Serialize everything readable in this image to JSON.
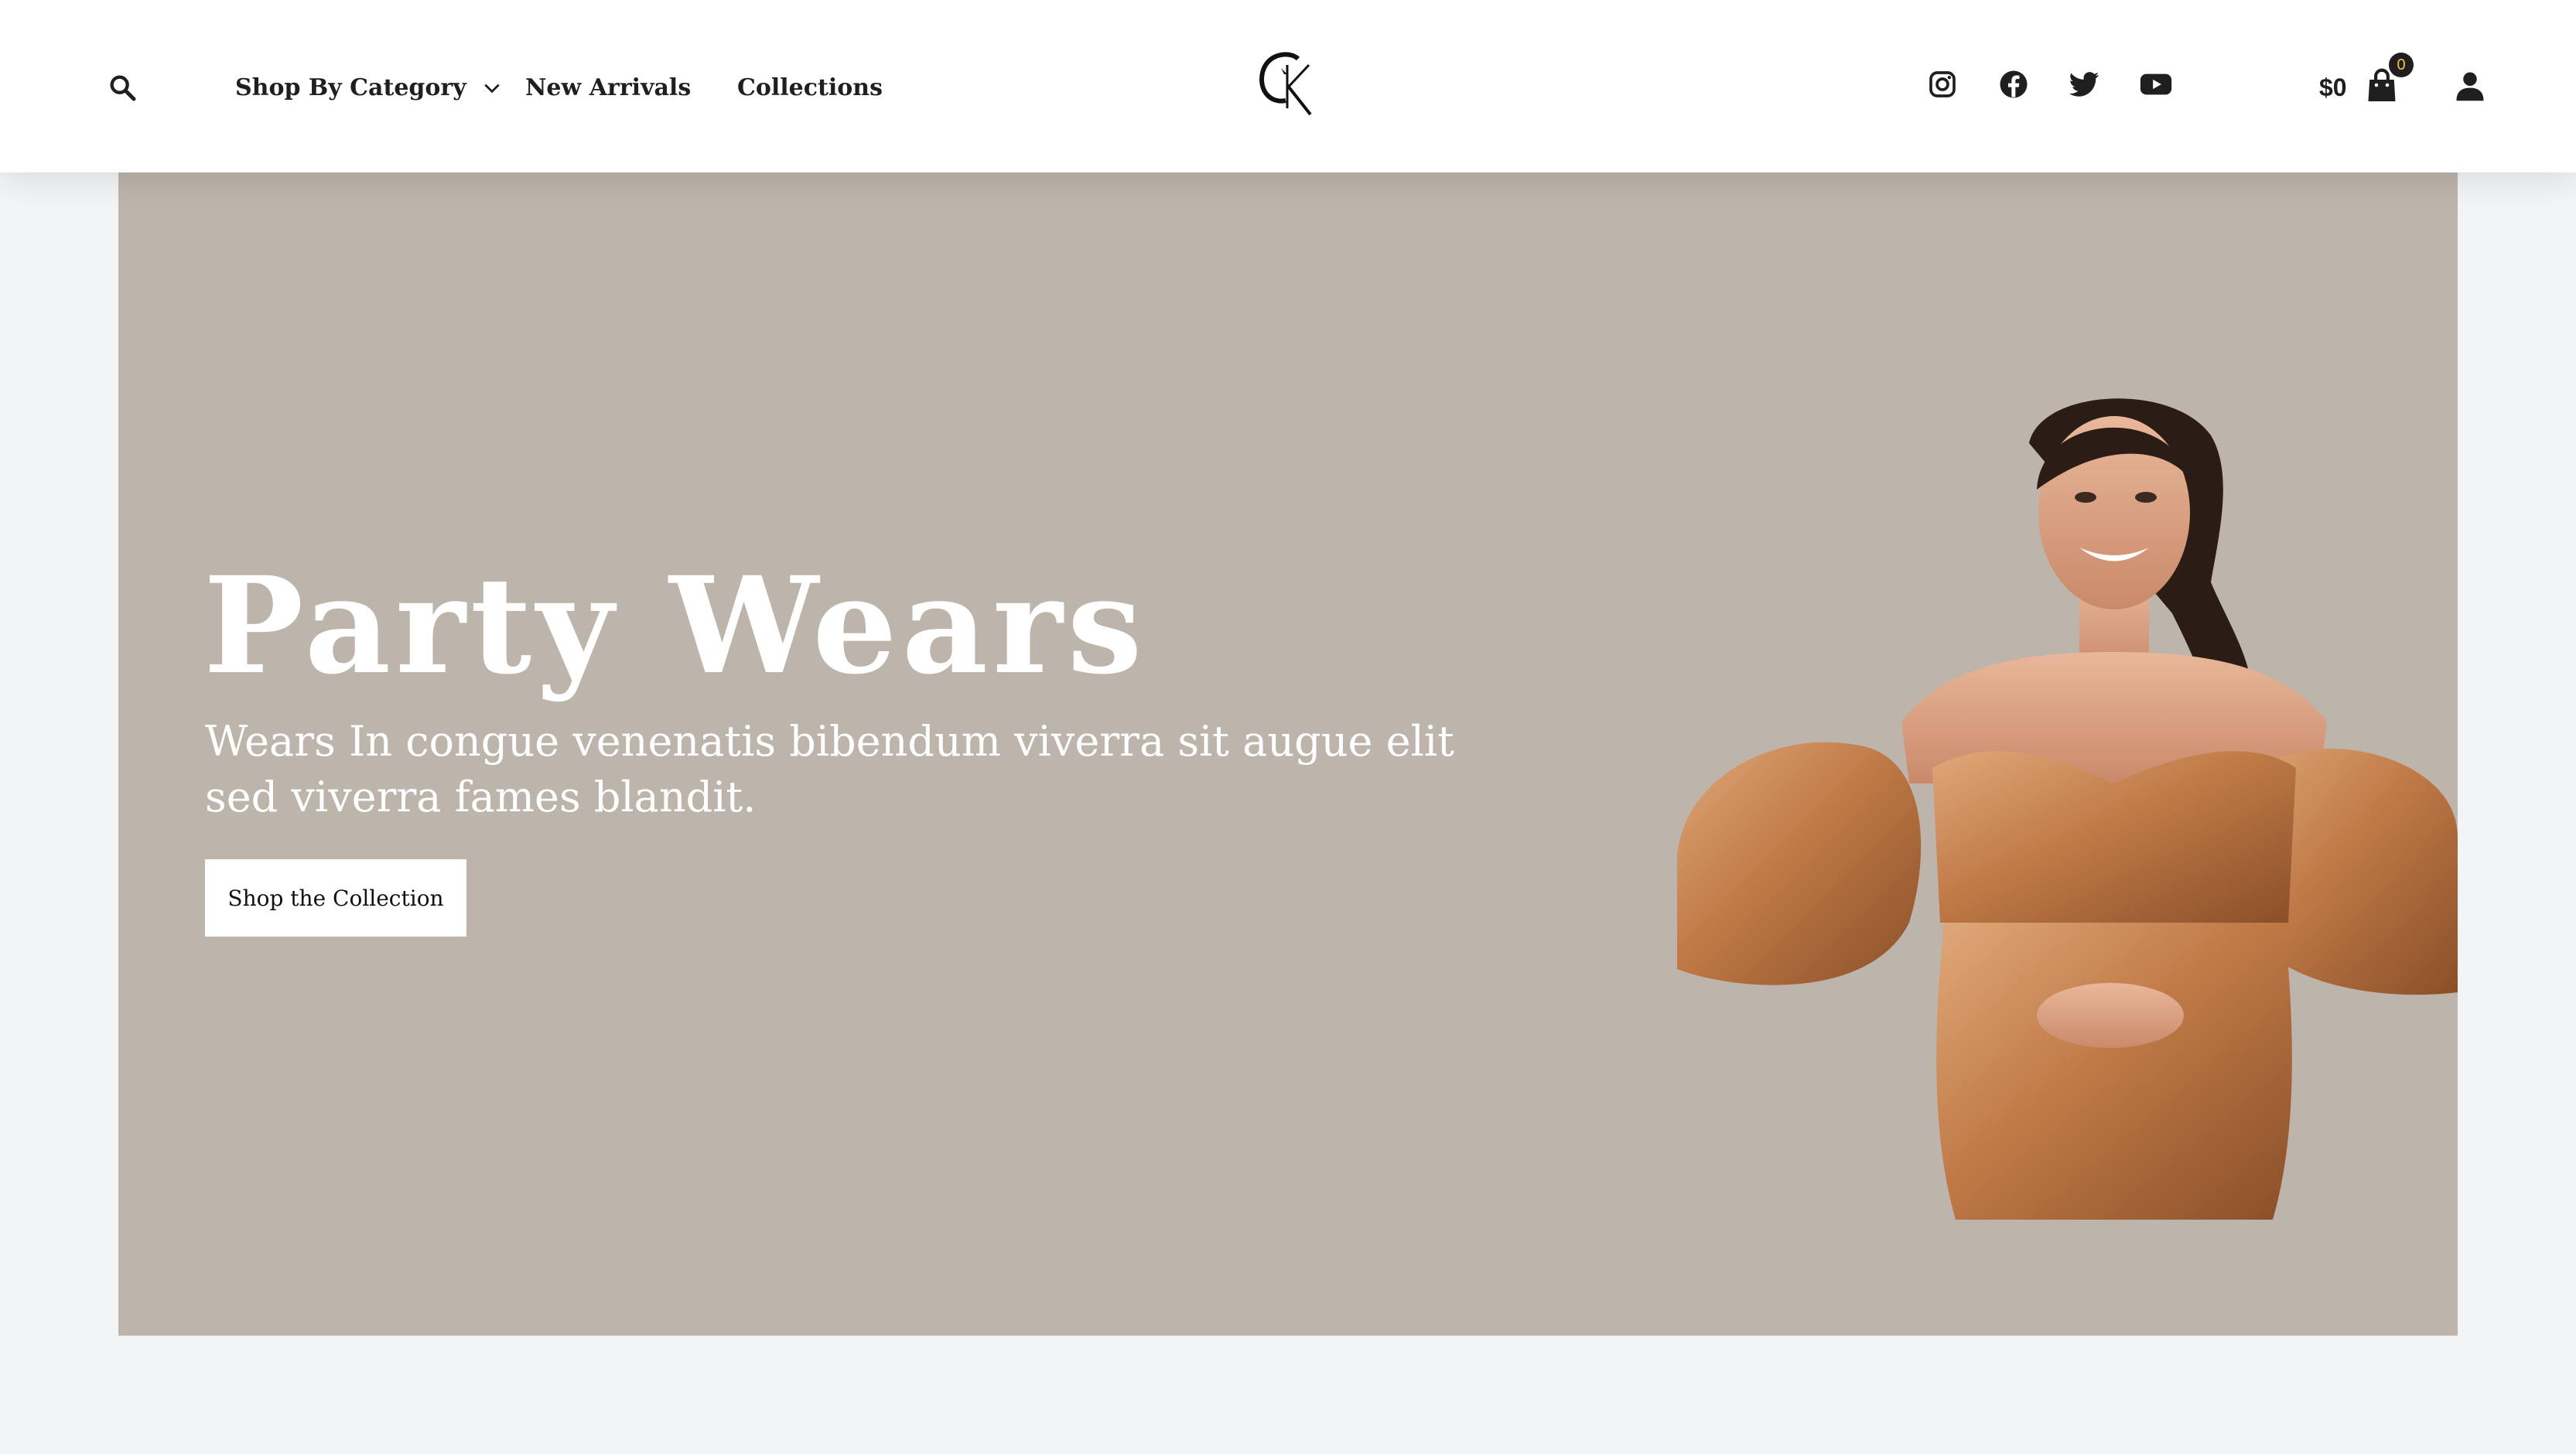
{
  "header": {
    "nav": {
      "shop_by_category": "Shop By Category",
      "new_arrivals": "New Arrivals",
      "collections": "Collections"
    },
    "logo_icon": "ck-monogram-logo",
    "social_icons": [
      "instagram-icon",
      "facebook-icon",
      "twitter-icon",
      "youtube-icon"
    ],
    "cart_total": "$0",
    "cart_count": "0"
  },
  "hero": {
    "title": "Party Wears",
    "subtitle": "Wears In congue venenatis bibendum viverra sit augue elit sed viverra fames blandit.",
    "cta_label": "Shop the Collection",
    "background_color": "#bdb4ab"
  },
  "colors": {
    "page_bg": "#f3f4f6",
    "text_dark": "#1f1f1f",
    "badge_accent": "#f4c542"
  }
}
